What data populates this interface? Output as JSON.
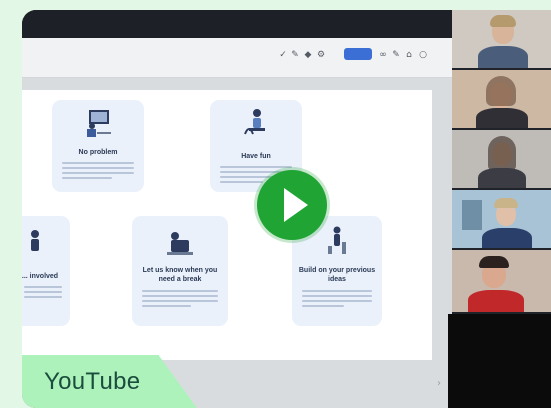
{
  "player": {
    "brand_label": "YouTube",
    "play_icon": "play-icon"
  },
  "presentation": {
    "cards": [
      {
        "title": "No problem",
        "illustration": "desk-person-icon"
      },
      {
        "title": "Have fun",
        "illustration": "person-sitting-icon"
      },
      {
        "title": "... involved",
        "illustration": "person-icon"
      },
      {
        "title": "Let us know when you need a break",
        "illustration": "person-resting-icon"
      },
      {
        "title": "Build on your previous ideas",
        "illustration": "person-building-icon"
      }
    ]
  },
  "participants": [
    {
      "name": "participant-1"
    },
    {
      "name": "participant-2"
    },
    {
      "name": "participant-3"
    },
    {
      "name": "participant-4"
    },
    {
      "name": "participant-5"
    }
  ],
  "colors": {
    "badge_bg": "#adf2ba",
    "badge_text": "#1b4d3e",
    "play_button": "#20a534",
    "page_bg": "#e3f7e7"
  }
}
